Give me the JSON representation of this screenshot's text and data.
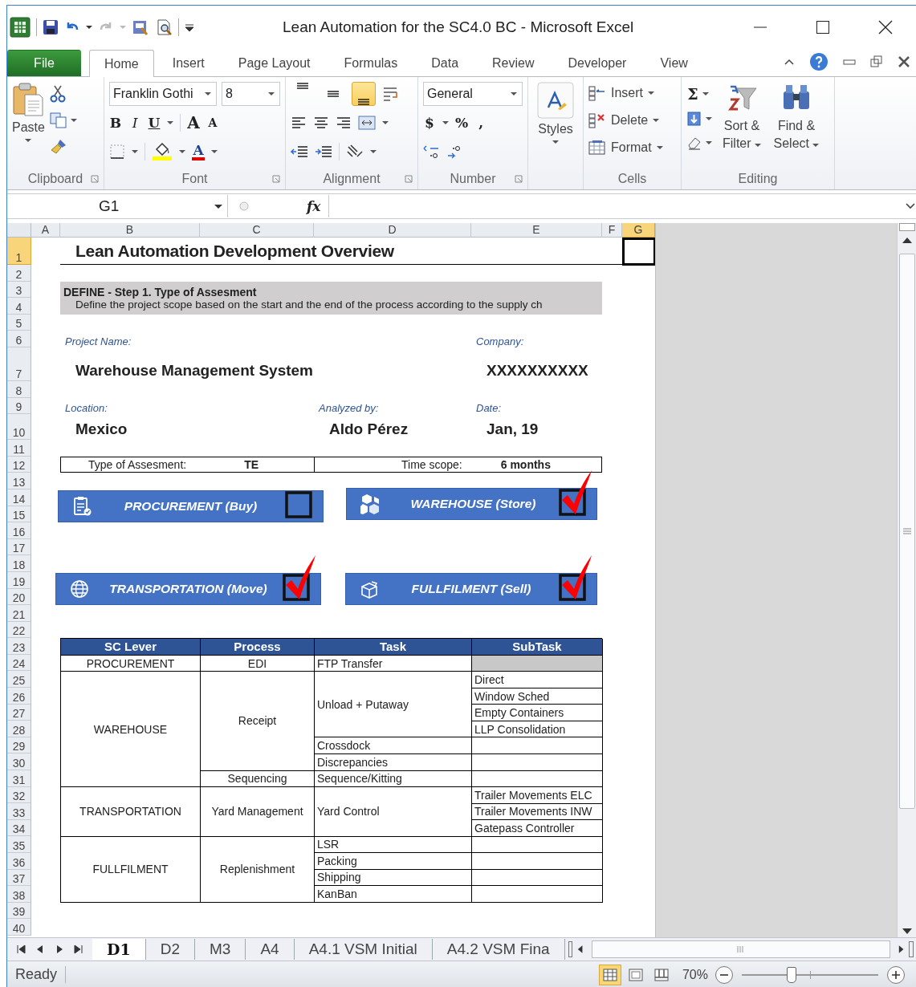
{
  "window": {
    "title": "Lean Automation for the SC4.0 BC  -  Microsoft Excel"
  },
  "ribbon_tabs": [
    {
      "label": "File",
      "kind": "file",
      "selected": false
    },
    {
      "label": "Home",
      "kind": "tab",
      "selected": true
    },
    {
      "label": "Insert",
      "kind": "tab",
      "selected": false
    },
    {
      "label": "Page Layout",
      "kind": "tab",
      "selected": false
    },
    {
      "label": "Formulas",
      "kind": "tab",
      "selected": false
    },
    {
      "label": "Data",
      "kind": "tab",
      "selected": false
    },
    {
      "label": "Review",
      "kind": "tab",
      "selected": false
    },
    {
      "label": "Developer",
      "kind": "tab",
      "selected": false
    },
    {
      "label": "View",
      "kind": "tab",
      "selected": false
    }
  ],
  "ribbon": {
    "clipboard": {
      "paste": "Paste",
      "label": "Clipboard"
    },
    "font": {
      "name": "Franklin Gothi",
      "size": "8",
      "bold": "B",
      "italic": "I",
      "underline": "U",
      "grow": "A",
      "shrink": "A",
      "color_letter": "A",
      "label": "Font"
    },
    "alignment": {
      "vertical": [
        {
          "selected": false
        },
        {
          "selected": false
        },
        {
          "selected": true
        }
      ],
      "label": "Alignment"
    },
    "number": {
      "format": "General",
      "currency": "$",
      "percent": "%",
      "comma": ",",
      "label": "Number"
    },
    "styles": {
      "label": "Styles"
    },
    "cells": {
      "items": [
        "Insert",
        "Delete",
        "Format"
      ],
      "label": "Cells"
    },
    "editing": {
      "sum": "Σ",
      "sort": "Sort & Filter",
      "find": "Find & Select",
      "label": "Editing"
    }
  },
  "formula_bar": {
    "name_box": "G1",
    "fx": "fx"
  },
  "columns": [
    {
      "label": "A",
      "selected": false
    },
    {
      "label": "B",
      "selected": false
    },
    {
      "label": "C",
      "selected": false
    },
    {
      "label": "D",
      "selected": false
    },
    {
      "label": "E",
      "selected": false
    },
    {
      "label": "F",
      "selected": false
    },
    {
      "label": "G",
      "selected": true
    }
  ],
  "rows": [
    {
      "label": "1",
      "selected": true
    },
    {
      "label": "2",
      "selected": false
    },
    {
      "label": "3",
      "selected": false
    },
    {
      "label": "4",
      "selected": false
    },
    {
      "label": "5",
      "selected": false
    },
    {
      "label": "6",
      "selected": false
    },
    {
      "label": "7",
      "selected": false
    },
    {
      "label": "8",
      "selected": false
    },
    {
      "label": "9",
      "selected": false
    },
    {
      "label": "10",
      "selected": false
    },
    {
      "label": "11",
      "selected": false
    },
    {
      "label": "12",
      "selected": false
    },
    {
      "label": "13",
      "selected": false
    },
    {
      "label": "14",
      "selected": false
    },
    {
      "label": "15",
      "selected": false
    },
    {
      "label": "16",
      "selected": false
    },
    {
      "label": "17",
      "selected": false
    },
    {
      "label": "18",
      "selected": false
    },
    {
      "label": "19",
      "selected": false
    },
    {
      "label": "20",
      "selected": false
    },
    {
      "label": "21",
      "selected": false
    },
    {
      "label": "22",
      "selected": false
    },
    {
      "label": "23",
      "selected": false
    },
    {
      "label": "24",
      "selected": false
    },
    {
      "label": "25",
      "selected": false
    },
    {
      "label": "26",
      "selected": false
    },
    {
      "label": "27",
      "selected": false
    },
    {
      "label": "28",
      "selected": false
    },
    {
      "label": "29",
      "selected": false
    },
    {
      "label": "30",
      "selected": false
    },
    {
      "label": "31",
      "selected": false
    },
    {
      "label": "32",
      "selected": false
    },
    {
      "label": "33",
      "selected": false
    },
    {
      "label": "34",
      "selected": false
    },
    {
      "label": "35",
      "selected": false
    },
    {
      "label": "36",
      "selected": false
    },
    {
      "label": "37",
      "selected": false
    },
    {
      "label": "38",
      "selected": false
    },
    {
      "label": "39",
      "selected": false
    },
    {
      "label": "40",
      "selected": false
    }
  ],
  "sheet": {
    "title": "Lean Automation Development Overview",
    "define": {
      "heading": "DEFINE - Step 1. Type of Assesment",
      "text": "Define the project scope based on the start and the end of the process according to the supply ch"
    },
    "fields": [
      {
        "label": "Project Name:",
        "value": "Warehouse Management System"
      },
      {
        "label": "Company:",
        "value": "XXXXXXXXXX"
      },
      {
        "label": "Location:",
        "value": "Mexico"
      },
      {
        "label": "Analyzed by:",
        "value": "Aldo Pérez"
      },
      {
        "label": "Date:",
        "value": "Jan, 19"
      }
    ],
    "assessment": {
      "type_label": "Type of Assesment:",
      "type_value": "TE",
      "scope_label": "Time scope:",
      "scope_value": "6 months"
    },
    "levers": [
      {
        "label": "PROCUREMENT (Buy)",
        "kind": "clipboard",
        "checked": false
      },
      {
        "label": "WAREHOUSE (Store)",
        "kind": "boxes",
        "checked": true
      },
      {
        "label": "TRANSPORTATION  (Move)",
        "kind": "globe",
        "checked": true
      },
      {
        "label": "FULLFILMENT (Sell)",
        "kind": "package",
        "checked": true
      }
    ]
  },
  "table": {
    "columns": [
      "SC Lever",
      "Process",
      "Task",
      "SubTask"
    ],
    "levers": [
      {
        "lever": "PROCUREMENT",
        "processes": [
          {
            "process": "EDI",
            "tasks": [
              {
                "task": "FTP Transfer",
                "shaded": true
              }
            ]
          }
        ]
      },
      {
        "lever": "WAREHOUSE",
        "processes": [
          {
            "process": "Receipt",
            "tasks": [
              {
                "task": "Unload + Putaway",
                "subtasks": [
                  "Direct",
                  "Window Sched",
                  "Empty Containers",
                  "LLP Consolidation"
                ]
              },
              {
                "task": "Crossdock",
                "shaded": false
              },
              {
                "task": "Discrepancies",
                "shaded": false
              }
            ]
          },
          {
            "process": "Sequencing",
            "tasks": [
              {
                "task": "Sequence/Kitting",
                "shaded": false
              }
            ]
          }
        ]
      },
      {
        "lever": "TRANSPORTATION",
        "processes": [
          {
            "process": "Yard Management",
            "tasks": [
              {
                "task": "Yard Control",
                "subtasks": [
                  "Trailer Movements ELC",
                  "Trailer Movements INW",
                  "Gatepass Controller"
                ]
              }
            ]
          }
        ]
      },
      {
        "lever": "FULLFILMENT",
        "processes": [
          {
            "process": "Replenishment",
            "tasks": [
              {
                "task": "LSR",
                "shaded": false
              },
              {
                "task": "Packing",
                "shaded": false
              },
              {
                "task": "Shipping",
                "shaded": false
              },
              {
                "task": "KanBan",
                "shaded": false
              }
            ]
          }
        ]
      }
    ]
  },
  "sheet_tabs": [
    {
      "label": "D1",
      "selected": true
    },
    {
      "label": "D2",
      "selected": false
    },
    {
      "label": "M3",
      "selected": false
    },
    {
      "label": "A4",
      "selected": false
    },
    {
      "label": "A4.1 VSM Initial",
      "selected": false
    },
    {
      "label": "A4.2 VSM Fina",
      "selected": false
    }
  ],
  "status_bar": {
    "status": "Ready",
    "views": [
      {
        "selected": true
      },
      {
        "selected": false
      },
      {
        "selected": false
      }
    ],
    "zoom": "70%",
    "zoom_slider": {
      "level": 0.36
    }
  }
}
